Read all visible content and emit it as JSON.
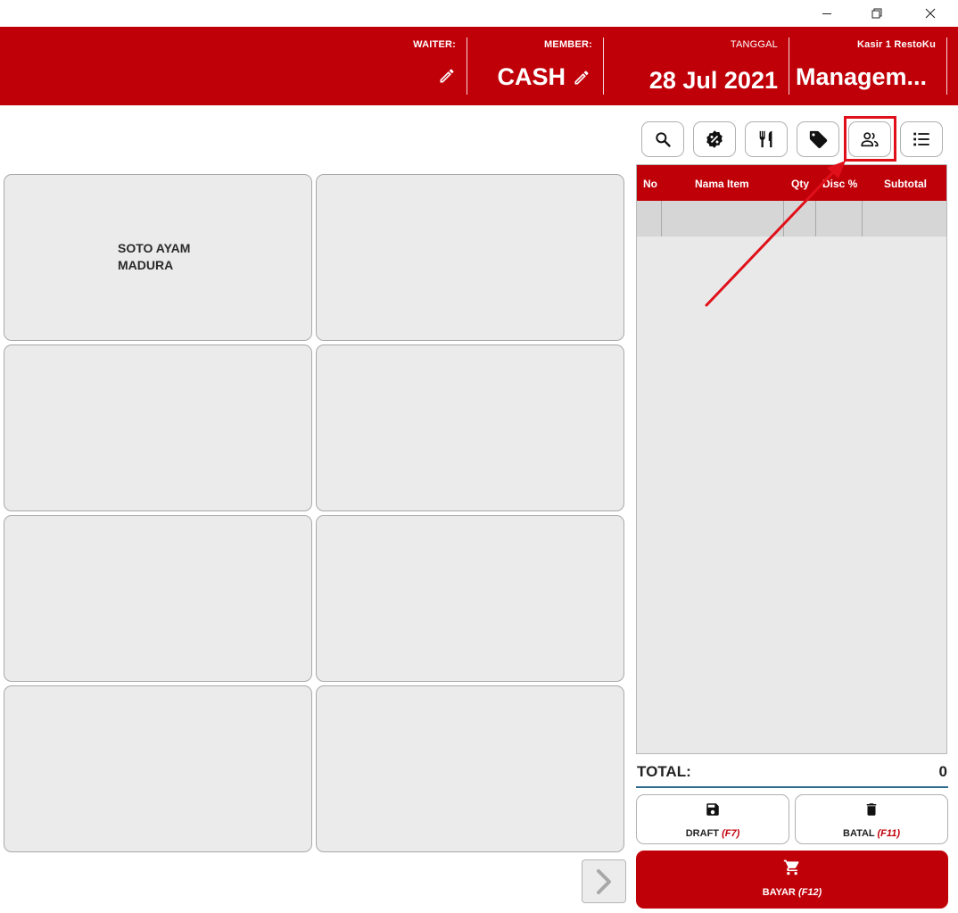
{
  "header": {
    "waiter_label": "WAITER:",
    "member_label": "MEMBER:",
    "member_value": "CASH",
    "date_label": "TANGGAL",
    "date_value": "28 Jul 2021",
    "cashier_label": "Kasir 1 RestoKu",
    "cashier_value": "Managem..."
  },
  "products": [
    {
      "label": "SOTO AYAM\nMADURA"
    },
    {
      "label": ""
    },
    {
      "label": ""
    },
    {
      "label": ""
    },
    {
      "label": ""
    },
    {
      "label": ""
    },
    {
      "label": ""
    },
    {
      "label": ""
    }
  ],
  "toolbar": {
    "buttons": [
      "search-icon",
      "discount-badge-icon",
      "cutlery-icon",
      "tag-icon",
      "customer-icon",
      "list-icon"
    ]
  },
  "order_table": {
    "columns": [
      "No",
      "Nama Item",
      "Qty",
      "Disc %",
      "Subtotal"
    ]
  },
  "total": {
    "label": "TOTAL:",
    "value": "0"
  },
  "actions": {
    "draft_label": "DRAFT",
    "draft_key": "(F7)",
    "cancel_label": "BATAL",
    "cancel_key": "(F11)",
    "pay_label": "BAYAR",
    "pay_key": "(F12)"
  },
  "colors": {
    "brand_red": "#c00009",
    "annotation_red": "#e0101a",
    "tile_bg": "#ebebeb"
  }
}
